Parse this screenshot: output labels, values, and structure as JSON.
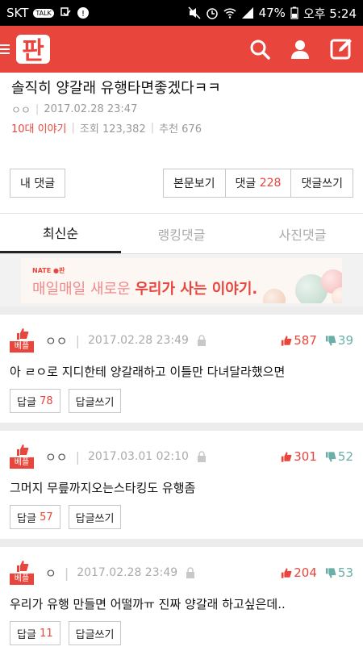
{
  "status": {
    "carrier": "SKT",
    "battery": "47%",
    "time": "오후 5:24"
  },
  "app": {
    "logo": "판"
  },
  "post": {
    "title": "솔직히 양갈래 유행타면좋겠다ㅋㅋ",
    "author": "ㅇㅇ",
    "date": "2017.02.28 23:47",
    "category": "10대 이야기",
    "views": "조회 123,382",
    "recommend": "추천 676"
  },
  "buttons": {
    "my_comments": "내 댓글",
    "view_body": "본문보기",
    "comments_label": "댓글",
    "comments_count": "228",
    "write_comment": "댓글쓰기"
  },
  "tabs": [
    "최신순",
    "랭킹댓글",
    "사진댓글"
  ],
  "banner": {
    "brand": "NATE ●판",
    "text_plain": "매일매일 새로운 ",
    "text_bold": "우리가 사는 이야기."
  },
  "comments": [
    {
      "badge": "베플",
      "author": "ㅇㅇ",
      "date": "2017.02.28 23:49",
      "up": "587",
      "down": "39",
      "text": "아 ㄹㅇ로 지디한테 양갈래하고 이틀만 다녀달라했으면",
      "reply_label": "답글",
      "reply_count": "78",
      "write_reply": "답글쓰기"
    },
    {
      "badge": "베플",
      "author": "ㅇㅇ",
      "date": "2017.03.01 02:10",
      "up": "301",
      "down": "52",
      "text": "그머지 무릎까지오는스타킹도 유행좀",
      "reply_label": "답글",
      "reply_count": "57",
      "write_reply": "답글쓰기"
    },
    {
      "badge": "베플",
      "author": "ㅇ",
      "date": "2017.02.28 23:49",
      "up": "204",
      "down": "53",
      "text": "우리가 유행 만들면 어떨까ㅠ 진짜 양갈래 하고싶은데..",
      "reply_label": "답글",
      "reply_count": "11",
      "write_reply": "답글쓰기"
    }
  ],
  "colors": {
    "brand": "#e8453c",
    "down_vote": "#6aaea8"
  }
}
